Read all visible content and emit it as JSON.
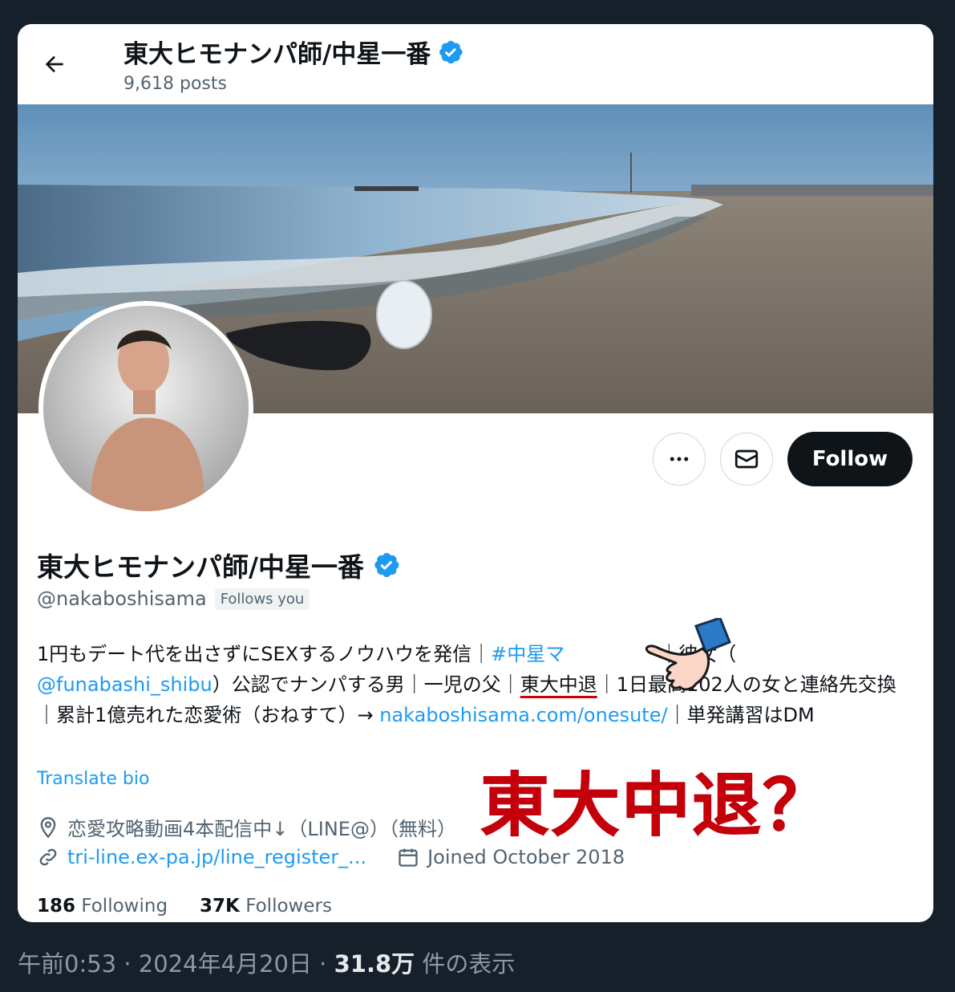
{
  "header": {
    "display_name": "東大ヒモナンパ師/中星一番",
    "posts_count": "9,618 posts"
  },
  "actions": {
    "follow_label": "Follow"
  },
  "profile": {
    "display_name": "東大ヒモナンパ師/中星一番",
    "handle": "@nakaboshisama",
    "follows_you": "Follows you",
    "bio": {
      "line1_a": "1円もデート代を出さずにSEXするノウハウを発信｜",
      "hashtag": "#中星マ",
      "line1_b": "｜彼女（",
      "mention": "@funabashi_shibu",
      "line2_a": "）公認でナンパする男｜一児の父｜",
      "underlined": "東大中退",
      "line2_b": "｜1日最高102人の女と連絡先交換｜累計1億売れた恋愛術（おねすて）→ ",
      "url": "nakaboshisama.com/onesute/",
      "line3": "｜単発講習はDM"
    },
    "translate": "Translate bio",
    "location": "恋愛攻略動画4本配信中↓（LINE@）（無料）",
    "website": "tri-line.ex-pa.jp/line_register_...",
    "joined": "Joined October 2018",
    "following_count": "186",
    "following_label": "Following",
    "followers_count": "37K",
    "followers_label": "Followers"
  },
  "overlay_text": "東大中退？",
  "footer": {
    "time": "午前0:53",
    "sep1": " · ",
    "date": "2024年4月20日",
    "sep2": " · ",
    "views": "31.8万",
    "views_label": " 件の表示"
  },
  "colors": {
    "accent": "#1d9bf0",
    "verified": "#1d9bf0",
    "overlay": "#c4000b",
    "background": "#15202b"
  },
  "icons": [
    "back-arrow-icon",
    "verified-badge-icon",
    "more-icon",
    "mail-icon",
    "location-icon",
    "link-icon",
    "calendar-icon",
    "pointing-hand-icon"
  ]
}
